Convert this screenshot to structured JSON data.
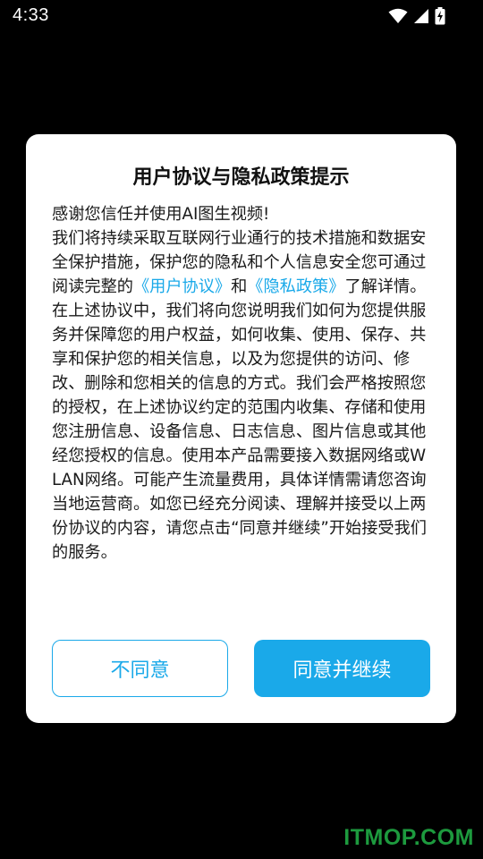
{
  "status_bar": {
    "time": "4:33",
    "icons": [
      "wifi-icon",
      "signal-icon",
      "battery-charging-icon"
    ]
  },
  "dialog": {
    "title": "用户协议与隐私政策提示",
    "body": {
      "greeting": "感谢您信任并使用AI图生视频!",
      "p1_text1": "我们将持续采取互联网行业通行的技术措施和数据安全保护措施，保护您的隐私和个人信息安全您可通过阅读完整的",
      "link_user_agreement": "《用户协议》",
      "p1_and": "和",
      "link_privacy_policy": "《隐私政策》",
      "p1_end": "了解详情。",
      "p2": "在上述协议中，我们将向您说明我们如何为您提供服务并保障您的用户权益，如何收集、使用、保存、共享和保护您的相关信息，以及为您提供的访问、修改、删除和您相关的信息的方式。我们会严格按照您的授权，在上述协议约定的范围内收集、存储和使用您注册信息、设备信息、日志信息、图片信息或其他经您授权的信息。使用本产品需要接入数据网络或WLAN网络。可能产生流量费用，具体详情需请您咨询当地运营商。如您已经充分阅读、理解并接受以上两份协议的内容，请您点击“同意并继续”开始接受我们的服务。"
    },
    "buttons": {
      "disagree": "不同意",
      "agree": "同意并继续"
    }
  },
  "watermark": "ITMOP.COM",
  "colors": {
    "accent": "#1aa9e9",
    "background": "#000000",
    "dialog": "#ffffff",
    "watermark": "#1d9a3e"
  }
}
